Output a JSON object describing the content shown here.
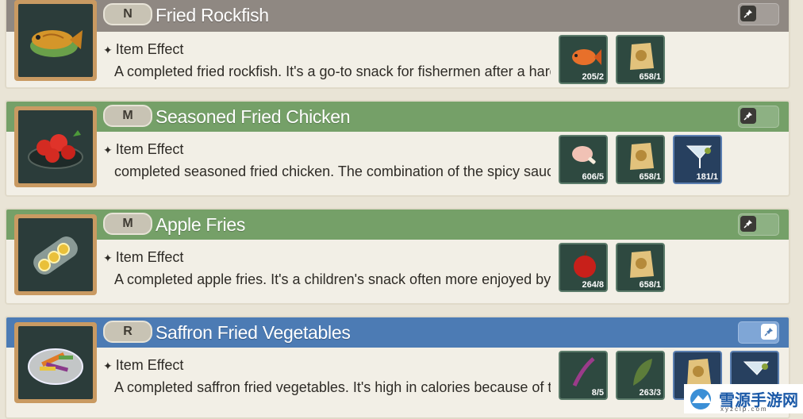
{
  "colors": {
    "header_gray": "#8f8882",
    "header_green": "#75a068",
    "header_blue": "#4c7bb4",
    "card_bg": "#f2efe6"
  },
  "items": [
    {
      "grade": "N",
      "title": "Fried Rockfish",
      "effect_label": "Item Effect",
      "description": "A completed fried rockfish. It's a go-to snack for fishermen after a hard",
      "icon": "fried-fish-icon",
      "pin_active": false,
      "materials": [
        {
          "icon": "rockfish-icon",
          "count": "205/2"
        },
        {
          "icon": "flour-sack-icon",
          "count": "658/1"
        }
      ]
    },
    {
      "grade": "M",
      "title": "Seasoned Fried Chicken",
      "effect_label": "Item Effect",
      "description": "completed seasoned fried chicken. The combination of the spicy sauce",
      "icon": "fried-chicken-icon",
      "pin_active": false,
      "materials": [
        {
          "icon": "chicken-leg-icon",
          "count": "606/5"
        },
        {
          "icon": "flour-sack-icon",
          "count": "658/1"
        },
        {
          "icon": "olive-oil-icon",
          "count": "181/1"
        }
      ]
    },
    {
      "grade": "M",
      "title": "Apple Fries",
      "effect_label": "Item Effect",
      "description": "A completed apple fries. It's a children's snack often more enjoyed by t",
      "icon": "apple-fries-icon",
      "pin_active": false,
      "materials": [
        {
          "icon": "apple-icon",
          "count": "264/8"
        },
        {
          "icon": "flour-sack-icon",
          "count": "658/1"
        }
      ]
    },
    {
      "grade": "R",
      "title": "Saffron Fried Vegetables",
      "effect_label": "Item Effect",
      "description": "A completed saffron fried vegetables. It's high in calories because of th",
      "icon": "fried-vegetables-icon",
      "pin_active": true,
      "materials": [
        {
          "icon": "saffron-icon",
          "count": "8/5"
        },
        {
          "icon": "herb-leaf-icon",
          "count": "263/3"
        },
        {
          "icon": "flour-sack-icon",
          "count": ""
        },
        {
          "icon": "olive-oil-icon",
          "count": ""
        }
      ]
    }
  ],
  "watermark": {
    "text": "雪源手游网",
    "sub": "xyzclp.com"
  }
}
